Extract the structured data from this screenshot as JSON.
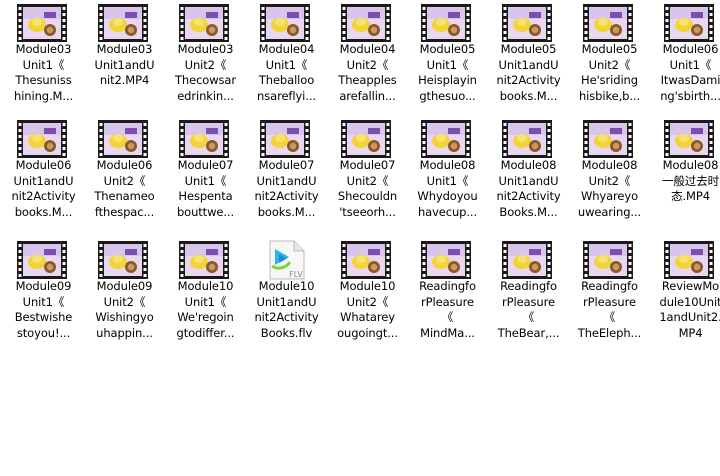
{
  "files": [
    {
      "label": "Module03\nUnit1《\nThesuniss\nhining.M...",
      "kind": "video"
    },
    {
      "label": "Module03\nUnit1andU\nnit2.MP4",
      "kind": "video"
    },
    {
      "label": "Module03\nUnit2《\nThecowsar\nedrinkin...",
      "kind": "video"
    },
    {
      "label": "Module04\nUnit1《\nTheballoo\nnsareflyi...",
      "kind": "video"
    },
    {
      "label": "Module04\nUnit2《\nTheapples\narefallin...",
      "kind": "video"
    },
    {
      "label": "Module05\nUnit1《\nHeisplayin\ngthesuo...",
      "kind": "video"
    },
    {
      "label": "Module05\nUnit1andU\nnit2Activity\nbooks.M...",
      "kind": "video"
    },
    {
      "label": "Module05\nUnit2《\nHe'sriding\nhisbike,b...",
      "kind": "video"
    },
    {
      "label": "Module06\nUnit1《\nItwasDami\nng'sbirth...",
      "kind": "video"
    },
    {
      "label": "Module06\nUnit1andU\nnit2Activity\nbooks.M...",
      "kind": "video"
    },
    {
      "label": "Module06\nUnit2《\nThenameo\nfthespac...",
      "kind": "video"
    },
    {
      "label": "Module07\nUnit1《\nHespenta\nbouttwe...",
      "kind": "video"
    },
    {
      "label": "Module07\nUnit1andU\nnit2Activity\nbooks.M...",
      "kind": "video"
    },
    {
      "label": "Module07\nUnit2《\nShecouldn\n'tseeorh...",
      "kind": "video"
    },
    {
      "label": "Module08\nUnit1《\nWhydoyou\nhavecup...",
      "kind": "video"
    },
    {
      "label": "Module08\nUnit1andU\nnit2Activity\nBooks.M...",
      "kind": "video"
    },
    {
      "label": "Module08\nUnit2《\nWhyareyo\nuwearing...",
      "kind": "video"
    },
    {
      "label": "Module08\n一般过去时\n态.MP4",
      "kind": "video"
    },
    {
      "label": "Module09\nUnit1《\nBestwishe\nstoyou!...",
      "kind": "video"
    },
    {
      "label": "Module09\nUnit2《\nWishingyo\nuhappin...",
      "kind": "video"
    },
    {
      "label": "Module10\nUnit1《\nWe'regoin\ngtodiffer...",
      "kind": "video"
    },
    {
      "label": "Module10\nUnit1andU\nnit2Activity\nBooks.flv",
      "kind": "flv",
      "badge": "FLV"
    },
    {
      "label": "Module10\nUnit2《\nWhatarey\nougoingt...",
      "kind": "video"
    },
    {
      "label": "Readingfo\nrPleasure\n《\nMindMa...",
      "kind": "video"
    },
    {
      "label": "Readingfo\nrPleasure\n《\nTheBear,...",
      "kind": "video"
    },
    {
      "label": "Readingfo\nrPleasure\n《\nTheEleph...",
      "kind": "video"
    },
    {
      "label": "ReviewMo\ndule10Unit\n1andUnit2.\nMP4",
      "kind": "video"
    }
  ]
}
